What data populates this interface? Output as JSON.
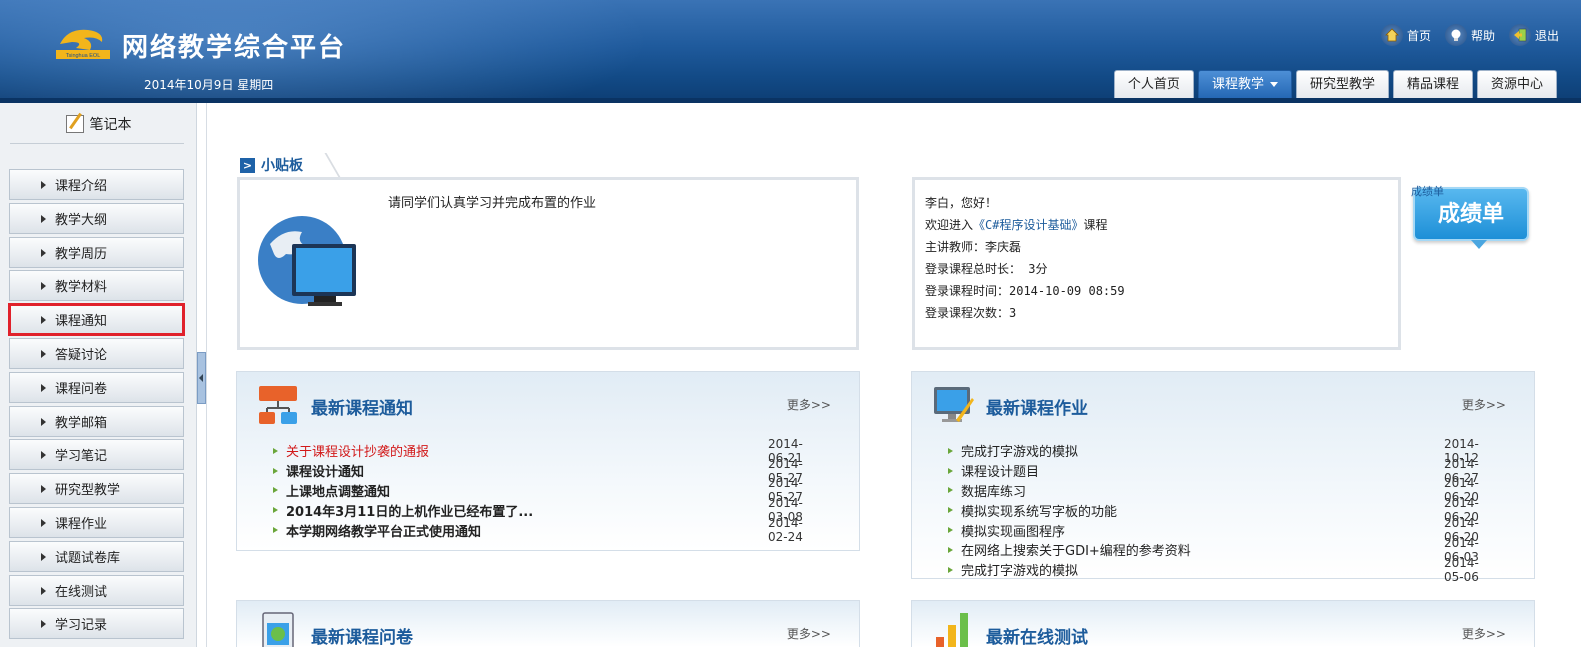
{
  "header": {
    "title": "网络教学综合平台",
    "logo_text": "Tsinghua EOL",
    "date": "2014年10月9日 星期四",
    "links": [
      {
        "label": "首页",
        "icon": "home-icon"
      },
      {
        "label": "帮助",
        "icon": "lightbulb-icon"
      },
      {
        "label": "退出",
        "icon": "exit-icon"
      }
    ],
    "tabs": [
      {
        "label": "个人首页"
      },
      {
        "label": "课程教学"
      },
      {
        "label": "研究型教学"
      },
      {
        "label": "精品课程"
      },
      {
        "label": "资源中心"
      }
    ]
  },
  "sidebar": {
    "notebook": "笔记本",
    "items": [
      {
        "label": "课程介绍"
      },
      {
        "label": "教学大纲"
      },
      {
        "label": "教学周历"
      },
      {
        "label": "教学材料"
      },
      {
        "label": "课程通知"
      },
      {
        "label": "答疑讨论"
      },
      {
        "label": "课程问卷"
      },
      {
        "label": "教学邮箱"
      },
      {
        "label": "学习笔记"
      },
      {
        "label": "研究型教学"
      },
      {
        "label": "课程作业"
      },
      {
        "label": "试题试卷库"
      },
      {
        "label": "在线测试"
      },
      {
        "label": "学习记录"
      }
    ]
  },
  "tipboard": {
    "title": "小贴板",
    "message": "请同学们认真学习并完成布置的作业"
  },
  "welcome": {
    "greeting": "李白，您好！",
    "enter_prefix": "欢迎进入",
    "course": "《C#程序设计基础》",
    "enter_suffix": "课程",
    "teacher": "主讲教师：李庆磊",
    "duration": "登录课程总时长： 3分",
    "login_time": "登录课程时间：2014-10-09 08:59",
    "login_count": "登录课程次数：3"
  },
  "score_badge": {
    "caption": "成绩单",
    "label": "成绩单"
  },
  "notices": {
    "title": "最新课程通知",
    "more": "更多>>",
    "items": [
      {
        "title": "关于课程设计抄袭的通报",
        "date": "2014-06-21"
      },
      {
        "title": "课程设计通知",
        "date": "2014-05-27"
      },
      {
        "title": "上课地点调整通知",
        "date": "2014-05-27"
      },
      {
        "title": "2014年3月11日的上机作业已经布置了...",
        "date": "2014-03-08"
      },
      {
        "title": "本学期网络教学平台正式使用通知",
        "date": "2014-02-24"
      }
    ]
  },
  "homework": {
    "title": "最新课程作业",
    "more": "更多>>",
    "items": [
      {
        "title": "完成打字游戏的模拟",
        "date": "2014-10-12"
      },
      {
        "title": "课程设计题目",
        "date": "2014-06-27"
      },
      {
        "title": "数据库练习",
        "date": "2014-06-20"
      },
      {
        "title": "模拟实现系统写字板的功能",
        "date": "2014-06-20"
      },
      {
        "title": "模拟实现画图程序",
        "date": "2014-06-20"
      },
      {
        "title": "在网络上搜索关于GDI+编程的参考资料",
        "date": "2014-06-03"
      },
      {
        "title": "完成打字游戏的模拟",
        "date": "2014-05-06"
      }
    ]
  },
  "surveys": {
    "title": "最新课程问卷",
    "more": "更多>>"
  },
  "tests": {
    "title": "最新在线测试",
    "more": "更多>>"
  },
  "colors": {
    "accent": "#1d5c9c",
    "header": "#1f5a9c",
    "highlight": "#e0212b",
    "alert_text": "#d21a1a"
  }
}
